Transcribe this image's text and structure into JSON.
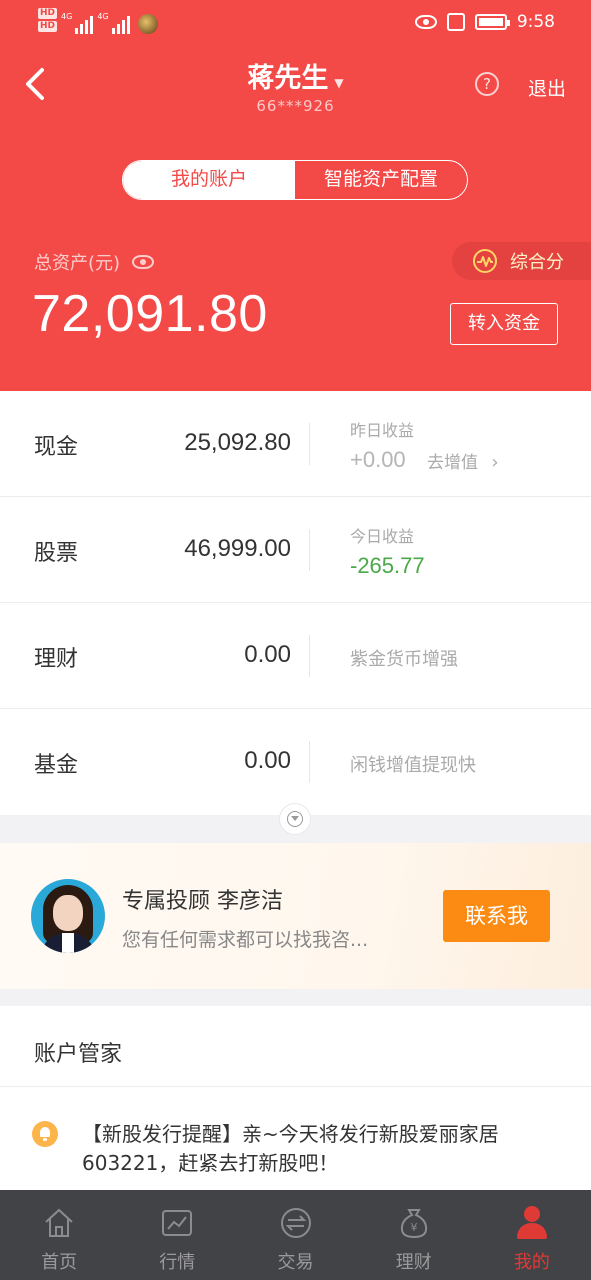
{
  "status_bar": {
    "hd1": "HD",
    "hd2": "HD",
    "net1": "4G",
    "net2": "4G",
    "time": "9:58"
  },
  "nav": {
    "title": "蒋先生",
    "account_masked": "66***926",
    "help_label": "?",
    "logout_label": "退出"
  },
  "segmented": {
    "my_account": "我的账户",
    "smart_allocation": "智能资产配置"
  },
  "summary": {
    "total_label": "总资产(元)",
    "total_value": "72,091.80",
    "score_label": "综合分",
    "transfer_label": "转入资金"
  },
  "assets": [
    {
      "name": "现金",
      "value": "25,092.80",
      "sub_label": "昨日收益",
      "sub_value": "+0.00",
      "action": "去增值"
    },
    {
      "name": "股票",
      "value": "46,999.00",
      "sub_label": "今日收益",
      "sub_value": "-265.77"
    },
    {
      "name": "理财",
      "value": "0.00",
      "desc": "紫金货币增强"
    },
    {
      "name": "基金",
      "value": "0.00",
      "desc": "闲钱增值提现快"
    }
  ],
  "advisor": {
    "title": "专属投顾 李彦洁",
    "description": "您有任何需求都可以找我咨...",
    "contact_label": "联系我"
  },
  "manager": {
    "title": "账户管家",
    "notice": "【新股发行提醒】亲~今天将发行新股爱丽家居603221，赶紧去打新股吧！"
  },
  "tabbar": {
    "items": [
      "首页",
      "行情",
      "交易",
      "理财",
      "我的"
    ],
    "active_index": 4
  },
  "colors": {
    "brand_red": "#f34a48",
    "positive_green": "#4aa847",
    "contact_orange": "#fc8b13",
    "tabbar_bg": "#424346"
  }
}
